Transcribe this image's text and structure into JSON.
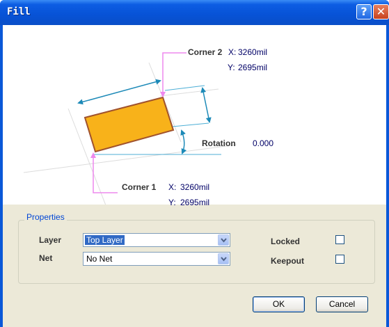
{
  "window": {
    "title": "Fill"
  },
  "titlebar": {
    "help_glyph": "?",
    "close_glyph": "✕"
  },
  "diagram": {
    "corner2": {
      "label": "Corner 2",
      "x_label": "X:",
      "x_value": "3260mil",
      "y_label": "Y:",
      "y_value": "2695mil"
    },
    "corner1": {
      "label": "Corner 1",
      "x_label": "X:",
      "x_value": "3260mil",
      "y_label": "Y:",
      "y_value": "2695mil"
    },
    "rotation": {
      "label": "Rotation",
      "value": "0.000"
    },
    "colors": {
      "fill": "#f8b21a",
      "fill_border": "#a0522d",
      "arrow": "#1d8ab8",
      "leader": "#ee88ee",
      "guide": "#4caed6"
    }
  },
  "properties": {
    "title": "Properties",
    "layer_label": "Layer",
    "layer_value": "Top Layer",
    "net_label": "Net",
    "net_value": "No Net",
    "locked_label": "Locked",
    "locked_checked": false,
    "keepout_label": "Keepout",
    "keepout_checked": false
  },
  "buttons": {
    "ok": "OK",
    "cancel": "Cancel"
  },
  "icons": [
    "help-icon",
    "close-icon",
    "chevron-down-icon"
  ]
}
